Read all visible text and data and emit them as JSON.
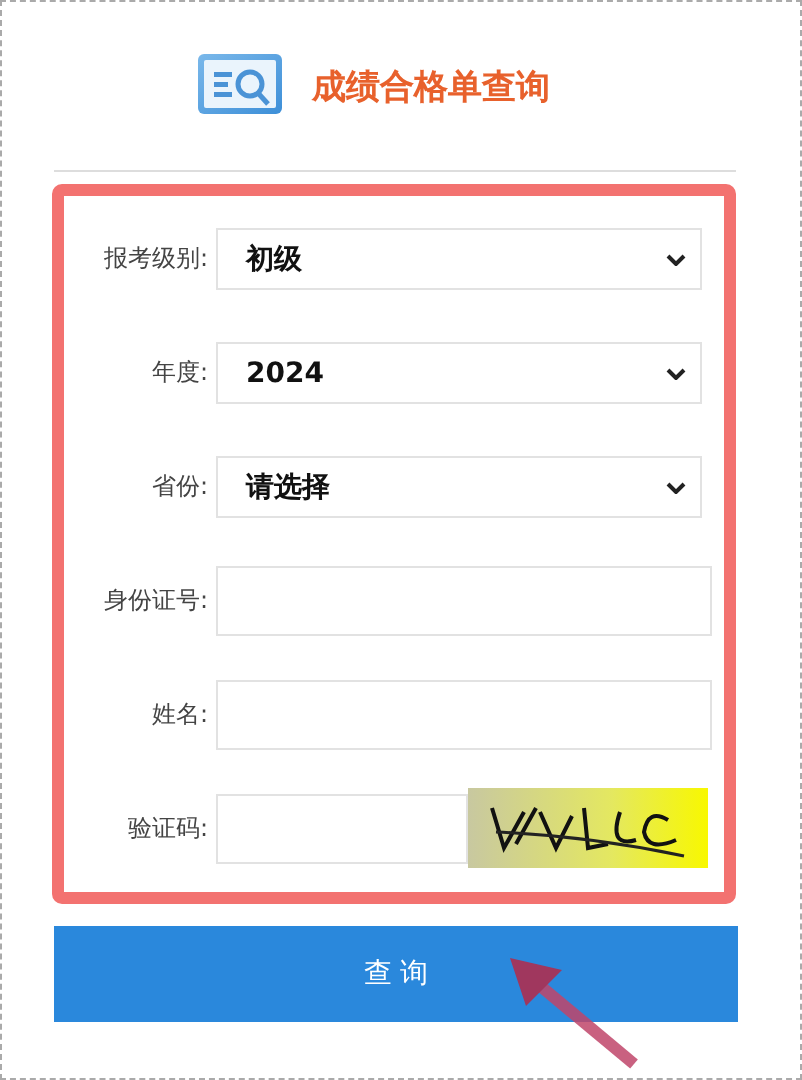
{
  "header": {
    "title": "成绩合格单查询"
  },
  "form": {
    "fields": [
      {
        "kind": "select",
        "label": "报考级别:",
        "value": "初级"
      },
      {
        "kind": "select",
        "label": "年度:",
        "value": "2024"
      },
      {
        "kind": "select",
        "label": "省份:",
        "value": "请选择"
      },
      {
        "kind": "input",
        "label": "身份证号:"
      },
      {
        "kind": "input",
        "label": "姓名:"
      },
      {
        "kind": "captcha",
        "label": "验证码:"
      }
    ]
  },
  "submit_button": {
    "label": "查 询"
  }
}
